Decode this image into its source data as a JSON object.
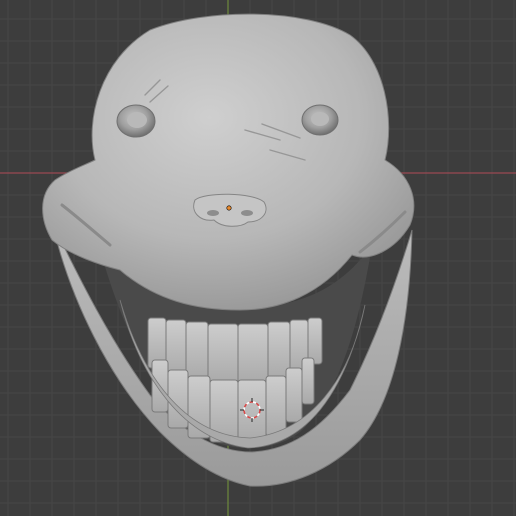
{
  "viewport": {
    "background_color": "#3d3d3d",
    "grid_minor_color": "#474747",
    "grid_major_color": "#515151",
    "axis_x_color": "#9a4a52",
    "axis_y_color": "#6e8a3c"
  },
  "scene": {
    "object": "sculpted-face-mesh",
    "material_base_color": "#b4b4b4",
    "origin_marker_color": "#e98a2e",
    "cursor_color_primary": "#d94848",
    "cursor_color_secondary": "#ffffff"
  }
}
